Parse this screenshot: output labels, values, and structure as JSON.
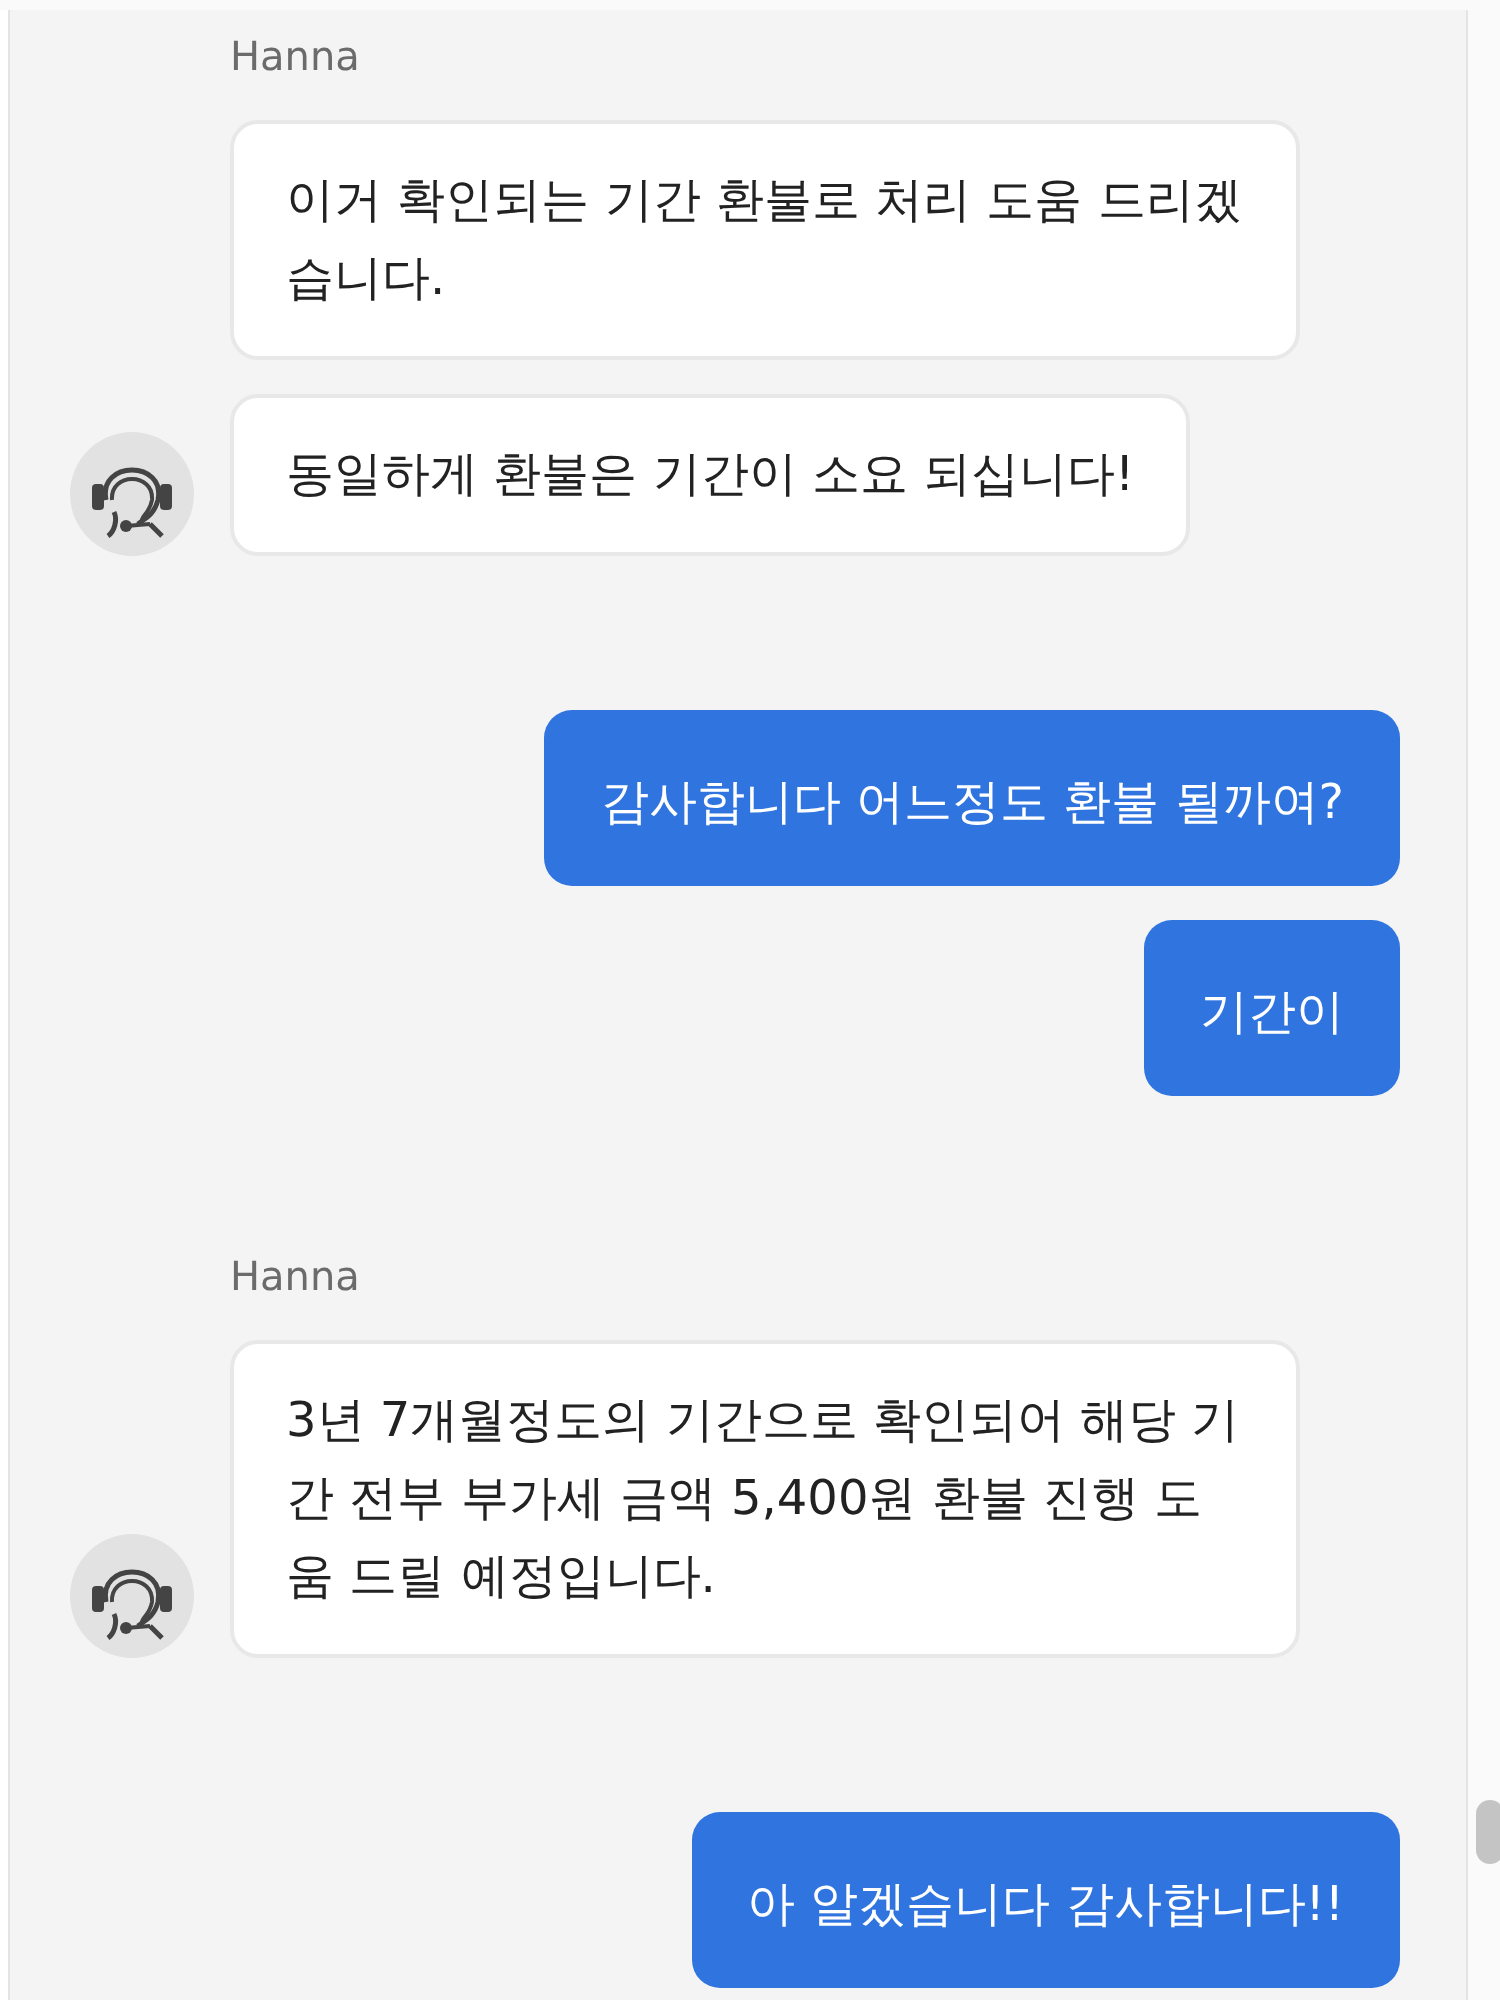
{
  "messages": [
    {
      "kind": "agent",
      "sender": "Hanna",
      "bubbles": [
        "이거 확인되는 기간 환불로 처리 도움 드리겠습니다.",
        "동일하게 환불은 기간이 소요 되십니다!"
      ]
    },
    {
      "kind": "user",
      "bubbles": [
        "감사합니다 어느정도 환불 될까여?",
        "기간이"
      ]
    },
    {
      "kind": "agent",
      "sender": "Hanna",
      "bubbles": [
        "3년 7개월정도의 기간으로 확인되어 해당 기간 전부 부가세 금액 5,400원 환불 진행 도움 드릴 예정입니다."
      ]
    },
    {
      "kind": "user",
      "bubbles": [
        "아 알겠습니다 감사합니다!!"
      ]
    }
  ]
}
